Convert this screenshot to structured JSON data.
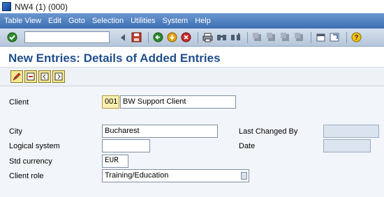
{
  "window": {
    "title": "NW4 (1) (000)"
  },
  "menu": [
    "Table View",
    "Edit",
    "Goto",
    "Selection",
    "Utilities",
    "System",
    "Help"
  ],
  "page": {
    "title": "New Entries: Details of Added Entries"
  },
  "form": {
    "client_label": "Client",
    "client_value": "001",
    "client_name": "BW Support Client",
    "city_label": "City",
    "city_value": "Bucharest",
    "logical_system_label": "Logical system",
    "logical_system_value": "",
    "std_currency_label": "Std currency",
    "std_currency_value": "EUR",
    "client_role_label": "Client role",
    "client_role_value": "Training/Education",
    "last_changed_by_label": "Last Changed By",
    "last_changed_by_value": "",
    "date_label": "Date",
    "date_value": ""
  }
}
